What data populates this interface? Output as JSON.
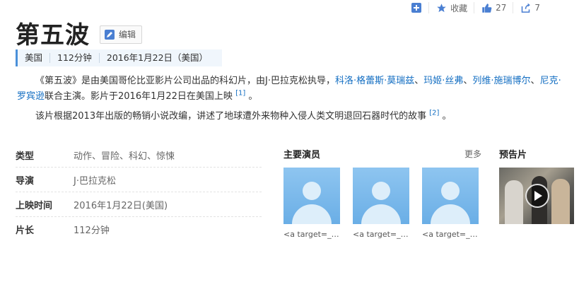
{
  "actions": {
    "favorite_label": "收藏",
    "like_count": "27",
    "share_count": "7"
  },
  "title": "第五波",
  "edit_label": "编辑",
  "meta": {
    "country": "美国",
    "duration": "112分钟",
    "release": "2016年1月22日（美国）"
  },
  "summary": {
    "p1_a": "《第五波》是由美国哥伦比亚影片公司出品的科幻片，由J·巴拉克松执导，",
    "cast_links": [
      "科洛·格蕾斯·莫瑞兹",
      "玛姬·丝弗",
      "列维·施瑞博尔",
      "尼克·罗宾逊"
    ],
    "p1_b": "联合主演。影片于2016年1月22日在美国上映",
    "ref1": "[1]",
    "p1_end": " 。",
    "p2": "该片根据2013年出版的畅销小说改编，讲述了地球遭外来物种入侵人类文明退回石器时代的故事",
    "ref2": "[2]",
    "p2_end": " 。"
  },
  "info": [
    {
      "key": "类型",
      "value": "动作、冒险、科幻、惊悚"
    },
    {
      "key": "导演",
      "value": "J·巴拉克松"
    },
    {
      "key": "上映时间",
      "value": "2016年1月22日(美国)"
    },
    {
      "key": "片长",
      "value": "112分钟"
    }
  ],
  "cast": {
    "title": "主要演员",
    "more": "更多",
    "names": [
      "<a target=_blank",
      "<a target=_blank",
      "<a target=_blank"
    ]
  },
  "trailer": {
    "title": "预告片"
  },
  "colors": {
    "link": "#136ec2",
    "accent": "#4a90d9",
    "meta_bg": "#f0f6fc",
    "icon": "#4a7fd2"
  }
}
